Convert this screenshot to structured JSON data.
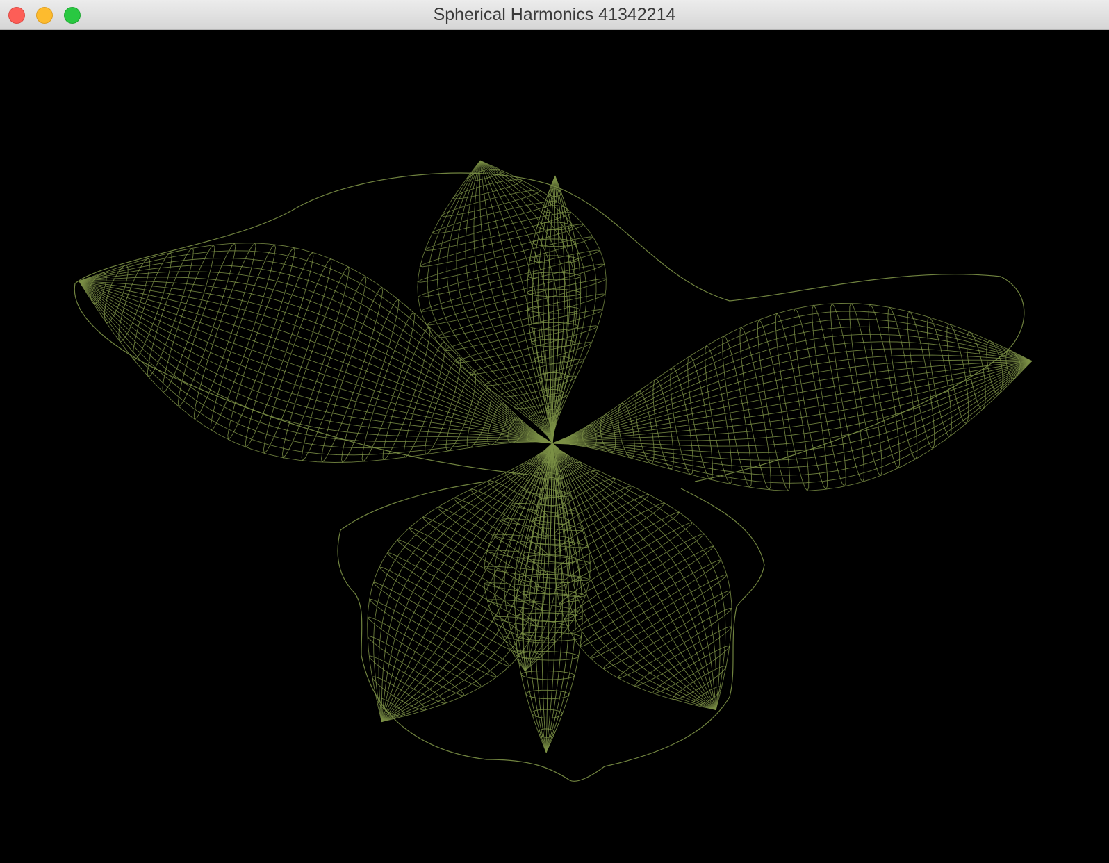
{
  "window": {
    "title": "Spherical Harmonics 41342214"
  },
  "viewport": {
    "background": "#000000",
    "mesh_color": "#7c9146",
    "render_mode": "wireframe"
  },
  "icons": {
    "close": "close-icon",
    "minimize": "minimize-icon",
    "maximize": "maximize-icon"
  }
}
